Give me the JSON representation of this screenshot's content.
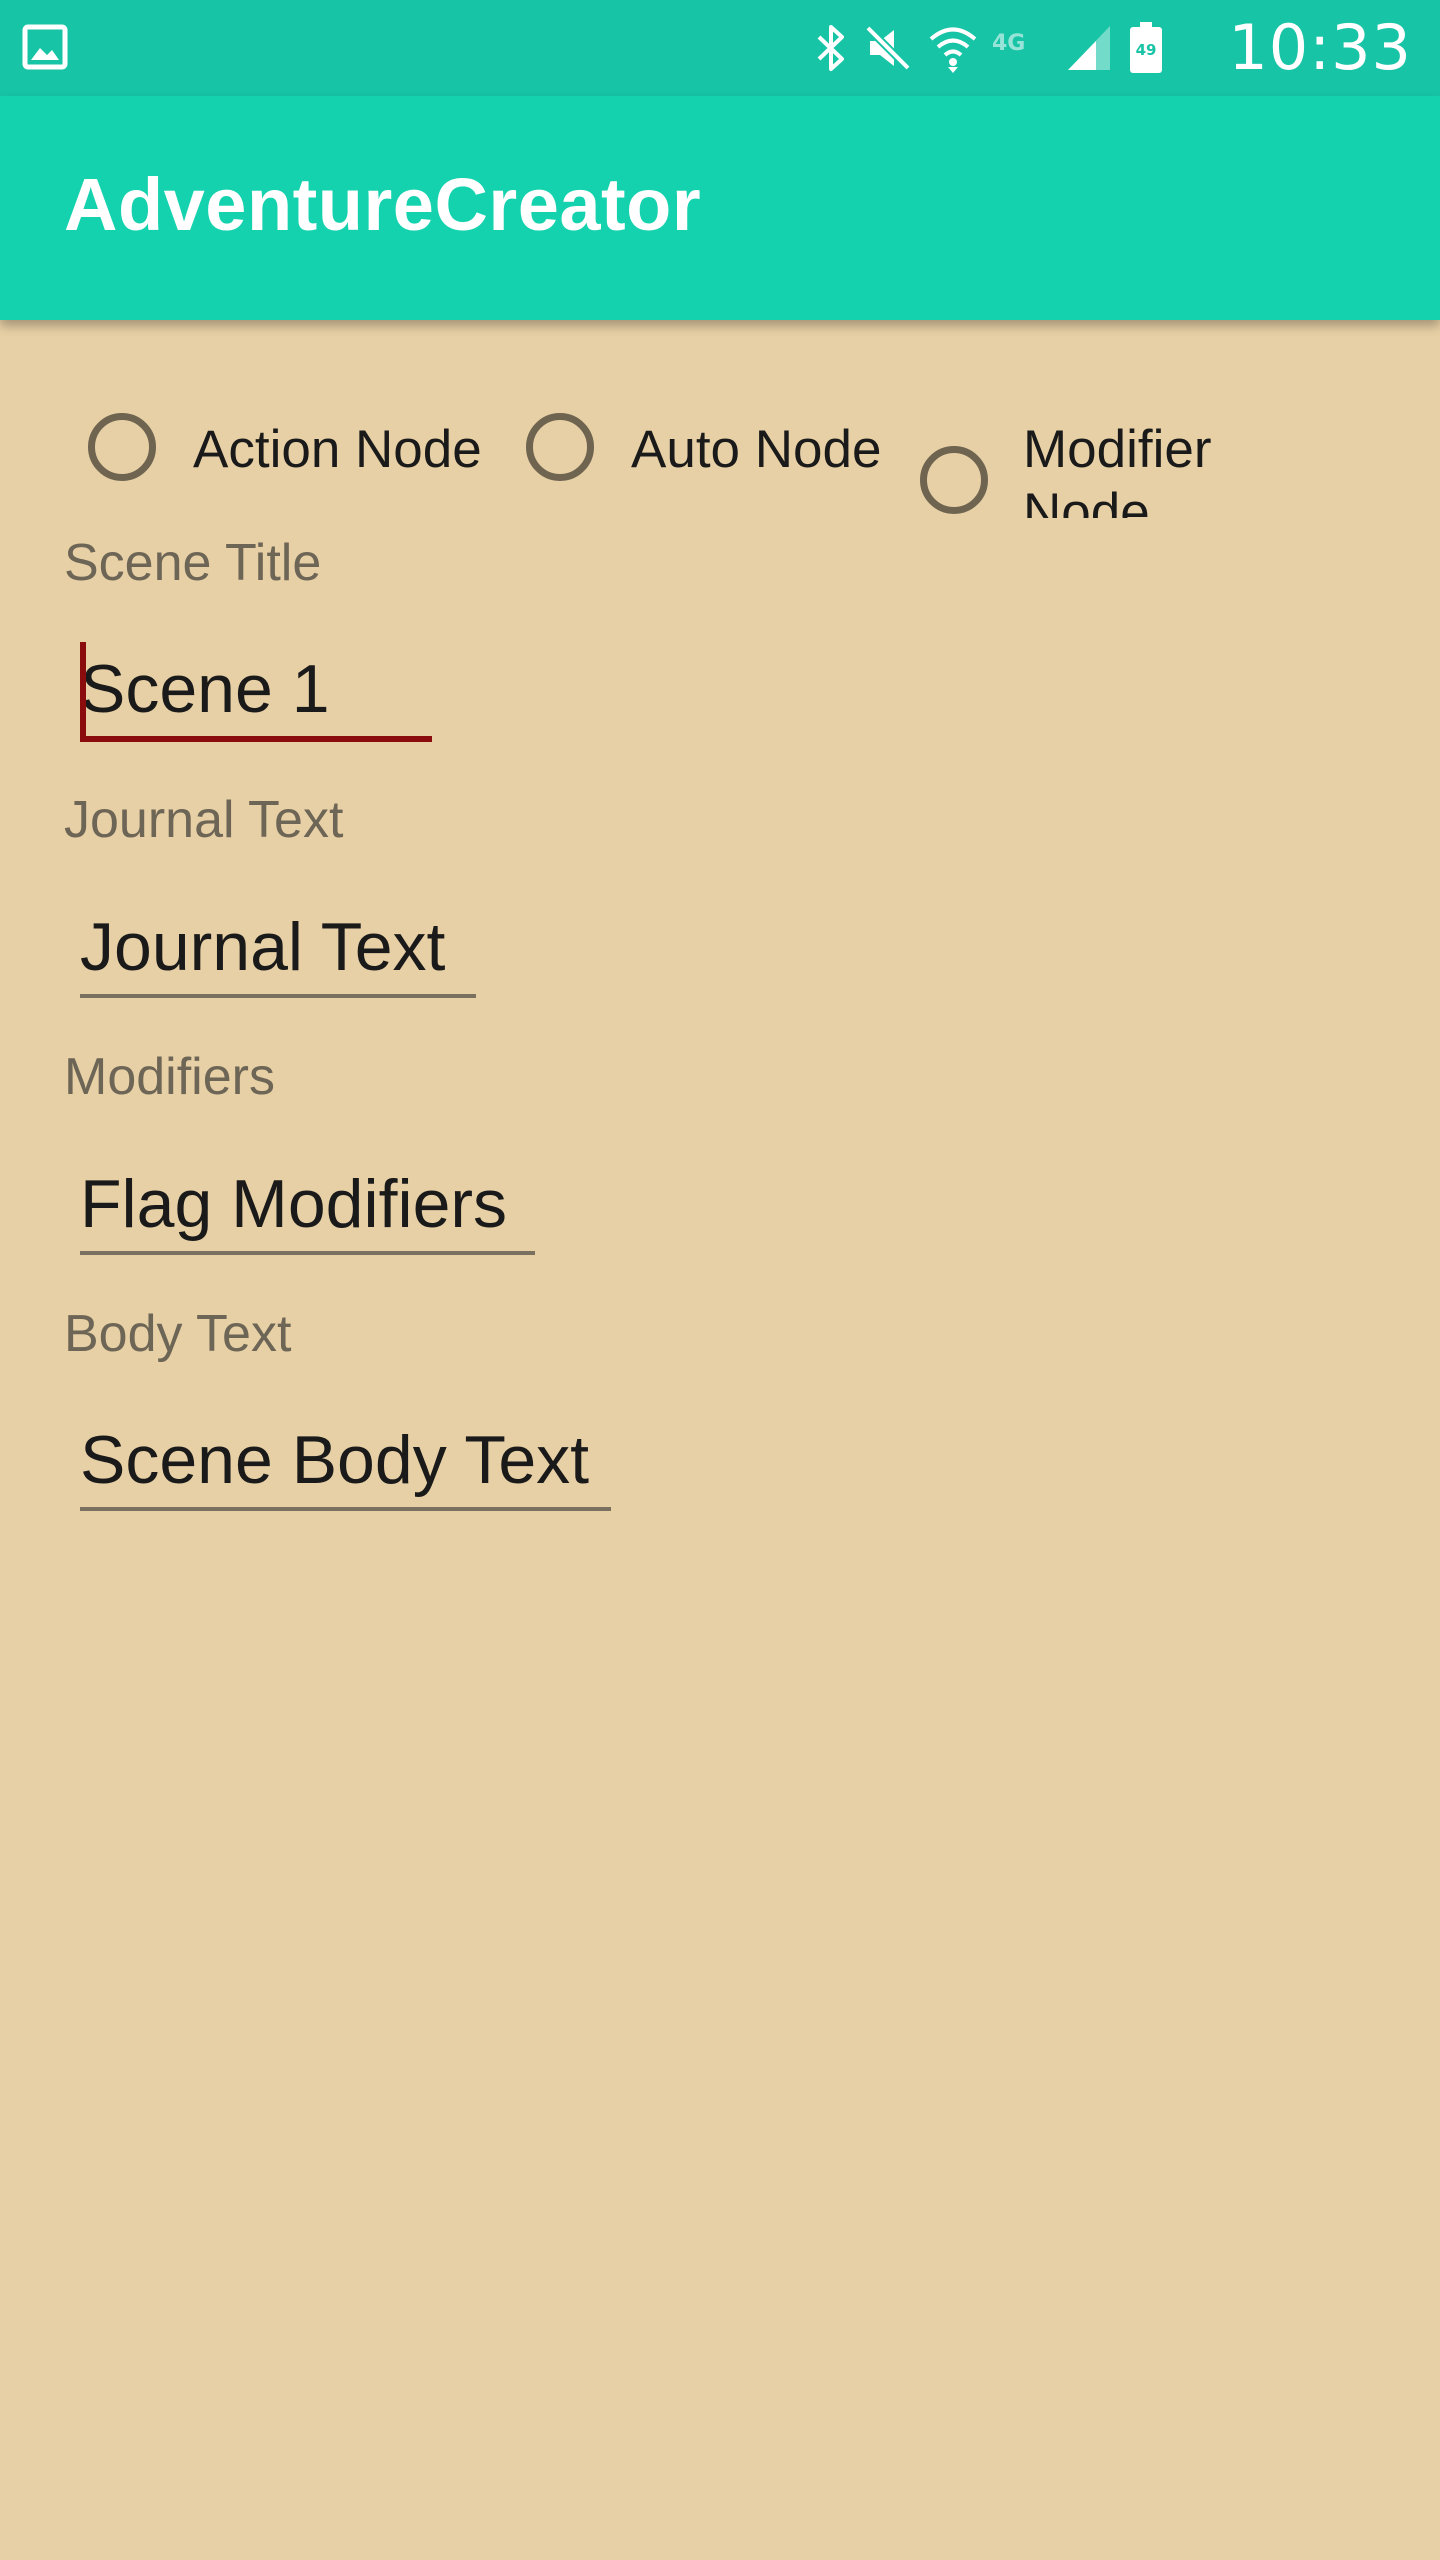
{
  "status_bar": {
    "time": "10:33",
    "battery_level": "49",
    "network_label": "4G",
    "icons": [
      "gallery-icon",
      "bluetooth-icon",
      "mute-icon",
      "wifi-icon",
      "network-4g-icon",
      "signal-icon",
      "battery-icon"
    ]
  },
  "app_bar": {
    "title": "AdventureCreator"
  },
  "node_types": {
    "action": "Action Node",
    "auto": "Auto Node",
    "modifier": "Modifier Node"
  },
  "form": {
    "scene_title": {
      "label": "Scene Title",
      "value": "Scene 1"
    },
    "journal_text": {
      "label": "Journal Text",
      "value": "Journal Text"
    },
    "modifiers": {
      "label": "Modifiers",
      "value": "Flag Modifiers"
    },
    "body_text": {
      "label": "Body Text",
      "value": "Scene Body Text"
    }
  },
  "colors": {
    "status_bar": "#17C4A6",
    "app_bar": "#15D2AF",
    "background": "#E7D0A5",
    "accent": "#8B0C0C",
    "label": "#6D6555"
  }
}
